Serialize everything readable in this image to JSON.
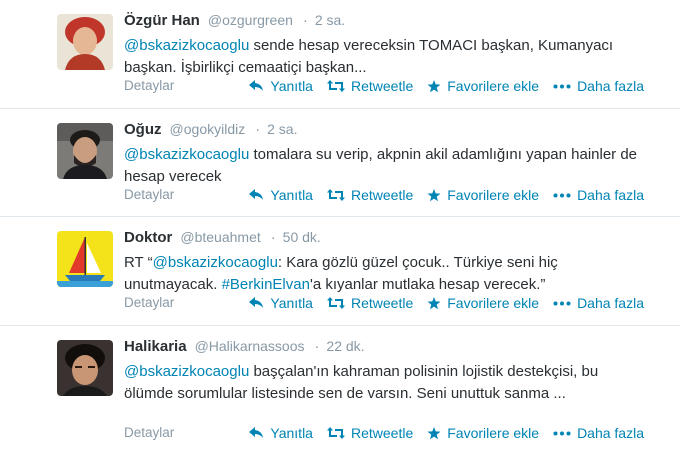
{
  "tweets": [
    {
      "fullname": "Özgür Han",
      "username": "@ozgurgreen",
      "sep": "·",
      "time": "2 sa.",
      "text_parts": [
        {
          "t": "@bskazizkocaoglu",
          "k": "mention"
        },
        {
          "t": " sende hesap vereceksin TOMACI başkan, Kumanyacı başkan. İşbirlikçi cemaatiçi başkan...",
          "k": "plain"
        }
      ]
    },
    {
      "fullname": "Oğuz",
      "username": "@ogokyildiz",
      "sep": "·",
      "time": "2 sa.",
      "text_parts": [
        {
          "t": "@bskazizkocaoglu",
          "k": "mention"
        },
        {
          "t": " tomalara su verip, akpnin akil adamlığını yapan hainler de hesap verecek",
          "k": "plain"
        }
      ]
    },
    {
      "fullname": "Doktor",
      "username": "@bteuahmet",
      "sep": "·",
      "time": "50 dk.",
      "text_parts": [
        {
          "t": "RT “",
          "k": "plain"
        },
        {
          "t": "@bskazizkocaoglu",
          "k": "mention"
        },
        {
          "t": ": Kara gözlü güzel çocuk.. Türkiye seni hiç unutmayacak. ",
          "k": "plain"
        },
        {
          "t": "#BerkinElvan",
          "k": "hashtag"
        },
        {
          "t": "'a kıyanlar mutlaka hesap verecek.”",
          "k": "plain"
        }
      ]
    },
    {
      "fullname": "Halikaria",
      "username": "@Halikarnassoos",
      "sep": "·",
      "time": "22 dk.",
      "text_parts": [
        {
          "t": "@bskazizkocaoglu",
          "k": "mention"
        },
        {
          "t": " başçalan'ın kahraman polisinin lojistik destekçisi, bu ölümde sorumlular listesinde sen de varsın. Seni  unuttuk sanma ...",
          "k": "plain"
        }
      ]
    }
  ],
  "footer": {
    "details": "Detaylar",
    "reply": "Yanıtla",
    "retweet": "Retweetle",
    "favorite": "Favorilere ekle",
    "more": "Daha fazla"
  },
  "colors": {
    "link": "#0084b4",
    "muted": "#8899a6",
    "text": "#292f33",
    "divider": "#e1e8ed"
  },
  "icons": [
    "reply-icon",
    "retweet-icon",
    "star-icon",
    "more-dots-icon"
  ]
}
